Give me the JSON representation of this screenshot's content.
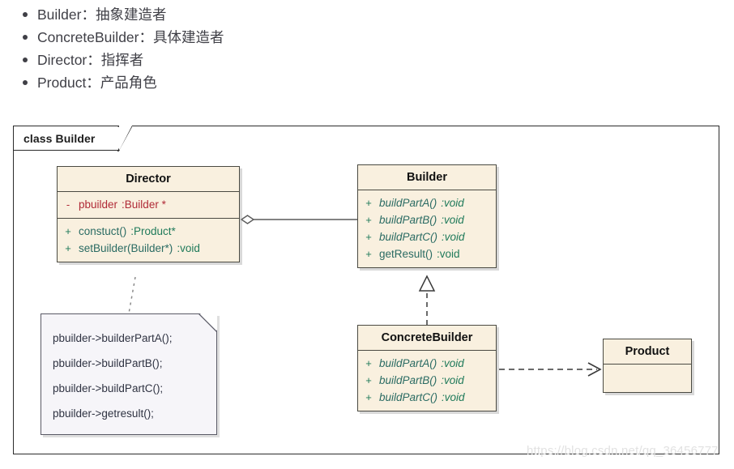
{
  "bullets": [
    "Builder：抽象建造者",
    "ConcreteBuilder：具体建造者",
    "Director：指挥者",
    "Product：产品角色"
  ],
  "diagram": {
    "frame_label": "class Builder",
    "classes": {
      "director": {
        "title": "Director",
        "attributes": [
          {
            "visibility": "-",
            "name": "pbuilder",
            "type": ":Builder *"
          }
        ],
        "operations": [
          {
            "visibility": "+",
            "name": "constuct()",
            "type": ":Product*"
          },
          {
            "visibility": "+",
            "name": "setBuilder(Builder*)",
            "type": ":void"
          }
        ]
      },
      "builder": {
        "title": "Builder",
        "operations": [
          {
            "visibility": "+",
            "name": "buildPartA()",
            "type": ":void"
          },
          {
            "visibility": "+",
            "name": "buildPartB()",
            "type": ":void"
          },
          {
            "visibility": "+",
            "name": "buildPartC()",
            "type": ":void"
          },
          {
            "visibility": "+",
            "name": "getResult()",
            "type": ":void"
          }
        ]
      },
      "concretebuilder": {
        "title": "ConcreteBuilder",
        "operations": [
          {
            "visibility": "+",
            "name": "buildPartA()",
            "type": ":void"
          },
          {
            "visibility": "+",
            "name": "buildPartB()",
            "type": ":void"
          },
          {
            "visibility": "+",
            "name": "buildPartC()",
            "type": ":void"
          }
        ]
      },
      "product": {
        "title": "Product"
      }
    },
    "note": {
      "lines": [
        "pbuilder->builderPartA();",
        "pbuilder->buildPartB();",
        "pbuilder->buildPartC();",
        "pbuilder->getresult();"
      ]
    },
    "relations": [
      {
        "name": "aggregation-director-builder",
        "kind": "aggregation",
        "from": "Director",
        "to": "Builder"
      },
      {
        "name": "realization-concretebuilder-builder",
        "kind": "realization",
        "from": "ConcreteBuilder",
        "to": "Builder"
      },
      {
        "name": "dependency-concretebuilder-product",
        "kind": "dependency",
        "from": "ConcreteBuilder",
        "to": "Product"
      },
      {
        "name": "note-anchor-director",
        "kind": "note-link",
        "from": "Note",
        "to": "Director"
      }
    ]
  },
  "watermark": "https://blog.csdn.net/qq_36456777",
  "colors": {
    "class_fill": "#f9f0df",
    "class_border": "#4a4a42",
    "note_fill": "#f6f5f9",
    "attribute_text": "#b02a37",
    "operation_text": "#2a6b63",
    "frame_border": "#2b2b2b"
  }
}
